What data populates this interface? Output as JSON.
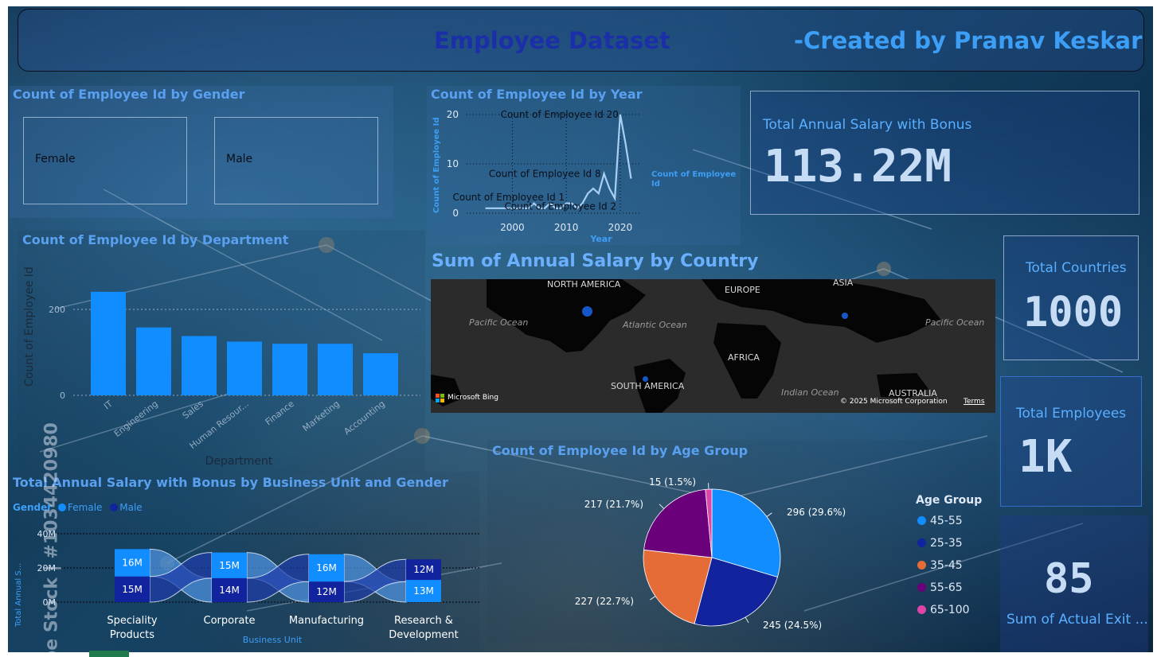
{
  "header": {
    "title": "Employee Dataset",
    "credit": "-Created by  Pranav Keskar"
  },
  "gender_card": {
    "title": "Count of Employee Id by Gender",
    "female_label": "Female",
    "male_label": "Male"
  },
  "year_chart": {
    "title": "Count of Employee Id by Year",
    "ylabel": "Count of Employee Id",
    "xlabel": "Year",
    "legend_label": "Count of Employee Id",
    "y_ticks": [
      "20",
      "10",
      "0"
    ],
    "x_ticks": [
      "2000",
      "2010",
      "2020"
    ],
    "annotations": [
      "Count of Employee Id 20",
      "Count of Employee Id 8",
      "Count of Employee Id 1",
      "Count of Employee Id 2"
    ]
  },
  "department_chart": {
    "title": "Count of Employee Id by Department",
    "ylabel": "Count of Employee Id",
    "xlabel": "Department",
    "y_ticks": [
      "200",
      "0"
    ]
  },
  "bu_chart": {
    "title": "Total Annual Salary with Bonus by Business Unit and Gender",
    "legend_title": "Gender",
    "legend_female": "Female",
    "legend_male": "Male",
    "ylabel": "Total Annual S...",
    "xlabel": "Business Unit",
    "y_ticks": [
      "40M",
      "20M",
      "0M"
    ]
  },
  "map": {
    "title": "Sum of Annual Salary by Country",
    "labels": {
      "north_america": "NORTH AMERICA",
      "europe": "EUROPE",
      "asia": "ASIA",
      "africa": "AFRICA",
      "south_america": "SOUTH AMERICA",
      "australia": "AUSTRALIA",
      "pacific_left": "Pacific Ocean",
      "atlantic": "Atlantic Ocean",
      "pacific_right": "Pacific Ocean",
      "indian": "Indian Ocean",
      "bing": "Microsoft Bing",
      "copyright": "© 2025 Microsoft Corporation",
      "terms": "Terms"
    }
  },
  "age_chart": {
    "title": "Count of Employee Id by Age Group",
    "legend_title": "Age Group"
  },
  "kpis": {
    "salary_label": "Total Annual Salary with Bonus",
    "salary_value": "113.22M",
    "countries_label": "Total Countries",
    "countries_value": "1000",
    "employees_label": "Total Employees",
    "employees_value": "1K",
    "exit_label": "Sum of Actual Exit ...",
    "exit_value": "85"
  },
  "watermark": "be Stock | #1034420980",
  "colors": {
    "title_blue": "#5aa0f0",
    "bar_blue": "#118dff",
    "header_title": "#1a2fa8",
    "header_credit": "#3d9ef5"
  },
  "chart_data": [
    {
      "type": "line",
      "name": "year",
      "x": [
        1995,
        1998,
        2001,
        2003,
        2004,
        2005,
        2006,
        2007,
        2008,
        2009,
        2010,
        2011,
        2012,
        2013,
        2014,
        2015,
        2016,
        2017,
        2018,
        2019,
        2020,
        2021,
        2022
      ],
      "values": [
        1,
        1,
        1,
        1,
        2,
        1,
        1,
        2,
        1,
        1,
        2,
        2,
        1,
        2,
        4,
        5,
        4,
        8,
        5,
        3,
        20,
        14,
        7
      ],
      "ylim": [
        0,
        20
      ]
    },
    {
      "type": "bar",
      "name": "department",
      "categories": [
        "IT",
        "Engineering",
        "Sales",
        "Human Resour...",
        "Finance",
        "Marketing",
        "Accounting"
      ],
      "values": [
        241,
        158,
        138,
        125,
        120,
        120,
        98
      ],
      "ylim": [
        0,
        250
      ]
    },
    {
      "type": "bar",
      "name": "business_unit_gender",
      "categories": [
        "Speciality Products",
        "Corporate",
        "Manufacturing",
        "Research & Development"
      ],
      "category_lines": [
        [
          "Speciality",
          "Products"
        ],
        [
          "Corporate"
        ],
        [
          "Manufacturing"
        ],
        [
          "Research &",
          "Development"
        ]
      ],
      "series": [
        {
          "name": "Female",
          "values": [
            16,
            15,
            16,
            13
          ],
          "labels": [
            "16M",
            "15M",
            "16M",
            "13M"
          ],
          "color": "#118dff"
        },
        {
          "name": "Male",
          "values": [
            15,
            14,
            12,
            12
          ],
          "labels": [
            "15M",
            "14M",
            "12M",
            "12M"
          ],
          "color": "#12239e"
        }
      ],
      "ylim": [
        0,
        40
      ]
    },
    {
      "type": "pie",
      "name": "age_group",
      "slices": [
        {
          "label": "45-55",
          "value": 296,
          "text": "296 (29.6%)",
          "color": "#118dff"
        },
        {
          "label": "25-35",
          "value": 245,
          "text": "245 (24.5%)",
          "color": "#12239e"
        },
        {
          "label": "35-45",
          "value": 227,
          "text": "227 (22.7%)",
          "color": "#e66c37"
        },
        {
          "label": "55-65",
          "value": 217,
          "text": "217 (21.7%)",
          "color": "#6b007b"
        },
        {
          "label": "65-100",
          "value": 15,
          "text": "15 (1.5%)",
          "color": "#e044a7"
        }
      ]
    }
  ]
}
